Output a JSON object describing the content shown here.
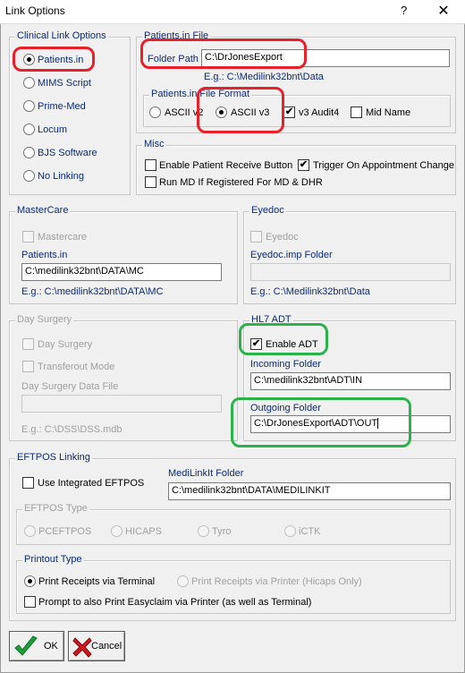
{
  "window": {
    "title": "Link Options",
    "help": "?",
    "close": "✕"
  },
  "clinical": {
    "legend": "Clinical Link Options",
    "options": [
      "Patients.in",
      "MIMS Script",
      "Prime-Med",
      "Locum",
      "BJS Software",
      "No Linking"
    ],
    "selected": "Patients.in"
  },
  "patients_file": {
    "legend": "Patients.in File",
    "folder_label": "Folder Path",
    "folder_value": "C:\\DrJonesExport",
    "example": "E.g.:  C:\\Medilink32bnt\\Data",
    "format_legend": "Patients.in File Format",
    "formats": [
      "ASCII v2",
      "ASCII v3"
    ],
    "selected_format": "ASCII v3",
    "v3_audit": "v3 Audit4",
    "mid_name": "Mid Name"
  },
  "misc": {
    "legend": "Misc",
    "enable_receive": "Enable Patient Receive Button",
    "trigger_appt": "Trigger On Appointment Change",
    "run_md": "Run MD If Registered For MD & DHR"
  },
  "mastercare": {
    "legend": "MasterCare",
    "check_label": "Mastercare",
    "field_label": "Patients.in",
    "field_value": "C:\\medilink32bnt\\DATA\\MC",
    "example": "E.g.:  C:\\medilink32bnt\\DATA\\MC"
  },
  "eyedoc": {
    "legend": "Eyedoc",
    "check_label": "Eyedoc",
    "field_label": "Eyedoc.imp Folder",
    "field_value": "",
    "example": "E.g.:  C:\\Medilink32bnt\\Data"
  },
  "day_surgery": {
    "legend": "Day Surgery",
    "check_label": "Day Surgery",
    "transfer_label": "Transferout Mode",
    "field_label": "Day Surgery Data File",
    "field_value": "",
    "example": "E.g.:  C:\\DSS\\DSS.mdb"
  },
  "hl7": {
    "legend": "HL7 ADT",
    "enable_label": "Enable ADT",
    "incoming_label": "Incoming Folder",
    "incoming_value": "C:\\medilink32bnt\\ADT\\IN",
    "outgoing_label": "Outgoing Folder",
    "outgoing_value": "C:\\DrJonesExport\\ADT\\OUT"
  },
  "eftpos": {
    "legend": "EFTPOS Linking",
    "use_label": "Use Integrated EFTPOS",
    "folder_label": "MediLinkIt Folder",
    "folder_value": "C:\\medilink32bnt\\DATA\\MEDILINKIT",
    "type_legend": "EFTPOS Type",
    "types": [
      "PCEFTPOS",
      "HICAPS",
      "Tyro",
      "iCTK"
    ],
    "printout_legend": "Printout Type",
    "print_terminal": "Print Receipts via Terminal",
    "print_printer": "Print Receipts via Printer (Hicaps Only)",
    "prompt_label": "Prompt to also Print Easyclaim via Printer (as well as Terminal)"
  },
  "buttons": {
    "ok": "OK",
    "cancel": "Cancel"
  },
  "colors": {
    "label_blue": "#0b2a7a",
    "highlight_red": "#e8202a",
    "highlight_green": "#2cb24a"
  }
}
